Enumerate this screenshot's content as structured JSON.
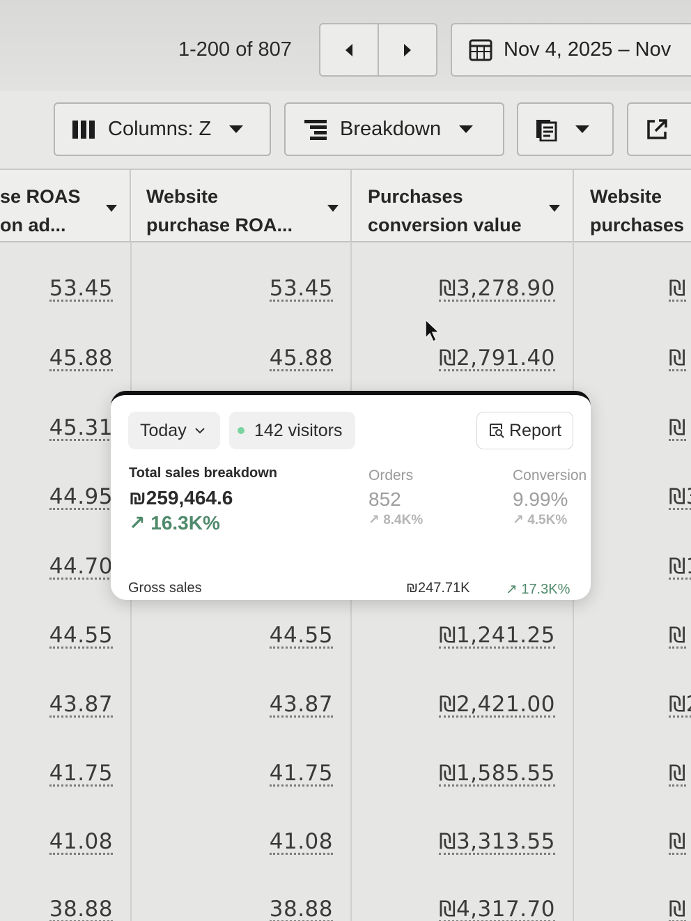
{
  "pager": {
    "range_text": "1-200 of 807",
    "date_range": "Nov 4, 2025 – Nov"
  },
  "toolbar": {
    "columns_label": "Columns: Z",
    "breakdown_label": "Breakdown"
  },
  "table": {
    "headers": [
      {
        "line1": "se ROAS",
        "line2": "on ad..."
      },
      {
        "line1": "Website",
        "line2": "purchase ROA..."
      },
      {
        "line1": "Purchases",
        "line2": "conversion value"
      },
      {
        "line1": "Website",
        "line2": "purchases"
      }
    ],
    "rows": [
      [
        "53.45",
        "53.45",
        "₪3,278.90",
        "₪"
      ],
      [
        "45.88",
        "45.88",
        "₪2,791.40",
        "₪"
      ],
      [
        "45.31",
        "",
        "",
        "₪"
      ],
      [
        "44.95",
        "",
        "",
        "₪3"
      ],
      [
        "44.70",
        "",
        "",
        "₪1"
      ],
      [
        "44.55",
        "44.55",
        "₪1,241.25",
        "₪"
      ],
      [
        "43.87",
        "43.87",
        "₪2,421.00",
        "₪2"
      ],
      [
        "41.75",
        "41.75",
        "₪1,585.55",
        "₪"
      ],
      [
        "41.08",
        "41.08",
        "₪3,313.55",
        "₪"
      ],
      [
        "38.88",
        "38.88",
        "₪4,317.70",
        "₪"
      ]
    ]
  },
  "card": {
    "period_label": "Today",
    "visitors_label": "142 visitors",
    "report_label": "Report",
    "total_sales": {
      "label": "Total sales breakdown",
      "value": "₪259,464.6",
      "change": "↗ 16.3K%"
    },
    "orders": {
      "label": "Orders",
      "value": "852",
      "change": "↗ 8.4K%"
    },
    "conversion": {
      "label": "Conversion",
      "value": "9.99%",
      "change": "↗ 4.5K%"
    },
    "gross": {
      "label": "Gross sales",
      "value": "₪247.71K",
      "change": "↗ 17.3K%"
    },
    "colors": {
      "positive": "#4f8a6b",
      "live_dot": "#7ad4a0"
    }
  }
}
